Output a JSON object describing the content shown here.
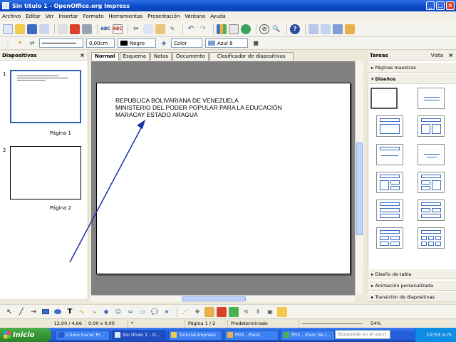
{
  "window": {
    "title": "Sin título 1 - OpenOffice.org Impress"
  },
  "menu": {
    "items": [
      "Archivo",
      "Editar",
      "Ver",
      "Insertar",
      "Formato",
      "Herramientas",
      "Presentación",
      "Ventana",
      "Ayuda"
    ]
  },
  "line_toolbar": {
    "width_value": "0,00cm",
    "line_color": "Negro",
    "fill_type": "Color",
    "fill_color": "Azul 8"
  },
  "slides_panel": {
    "title": "Diapositivas",
    "slides": [
      {
        "number": "1",
        "label": "Página 1"
      },
      {
        "number": "2",
        "label": "Página 2"
      }
    ]
  },
  "view_tabs": [
    "Normal",
    "Esquema",
    "Notas",
    "Documento",
    "Clasificador de diapositivas"
  ],
  "slide": {
    "lines": [
      "REPUBLICA BOLIVARIANA DE VENEZUELA",
      "MINISTERIO DEL PODER POPULAR PARA LA EDUCACIÓN",
      "MARACAY ESTADO ARAGUA"
    ]
  },
  "task_pane": {
    "title": "Tareas",
    "view_label": "Vista",
    "sections_top": [
      "Páginas maestras",
      "Diseños"
    ],
    "sections_bottom": [
      "Diseño de tabla",
      "Animación personalizada",
      "Transición de diapositivas"
    ]
  },
  "status": {
    "position": "12,00 / 4,66",
    "size": "0,00 x 0,00",
    "modified": "*",
    "page": "Página 1 / 2",
    "style": "Predeterminado",
    "zoom": "54%"
  },
  "taskbar": {
    "start": "Inicio",
    "tasks": [
      "Cómo hacer Pr...",
      "Sin título 1 - O...",
      "Tutorial-Impress",
      "P03 - Paint",
      "P03 - Visor de i..."
    ],
    "search_placeholder": "Búsqueda en el escri",
    "clock": "10:53 a.m."
  },
  "colors": {
    "accent": "#2f5fb4",
    "arrow": "#1b2fa8",
    "titlebar": "#0a49c6"
  }
}
